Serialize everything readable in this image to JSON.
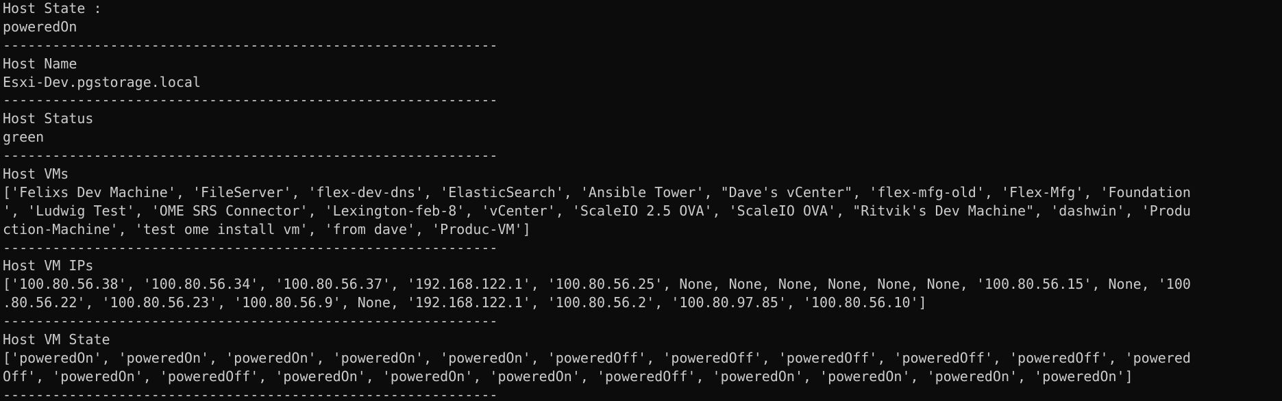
{
  "terminal": {
    "lines": [
      "Host State :",
      "poweredOn",
      "------------------------------------------------------------",
      "Host Name",
      "Esxi-Dev.pgstorage.local",
      "------------------------------------------------------------",
      "Host Status",
      "green",
      "------------------------------------------------------------",
      "Host VMs",
      "['Felixs Dev Machine', 'FileServer', 'flex-dev-dns', 'ElasticSearch', 'Ansible Tower', \"Dave's vCenter\", 'flex-mfg-old', 'Flex-Mfg', 'Foundation",
      "', 'Ludwig Test', 'OME SRS Connector', 'Lexington-feb-8', 'vCenter', 'ScaleIO 2.5 OVA', 'ScaleIO OVA', \"Ritvik's Dev Machine\", 'dashwin', 'Produ",
      "ction-Machine', 'test ome install vm', 'from dave', 'Produc-VM']",
      "------------------------------------------------------------",
      "Host VM IPs",
      "['100.80.56.38', '100.80.56.34', '100.80.56.37', '192.168.122.1', '100.80.56.25', None, None, None, None, None, None, '100.80.56.15', None, '100",
      ".80.56.22', '100.80.56.23', '100.80.56.9', None, '192.168.122.1', '100.80.56.2', '100.80.97.85', '100.80.56.10']",
      "------------------------------------------------------------",
      "Host VM State",
      "['poweredOn', 'poweredOn', 'poweredOn', 'poweredOn', 'poweredOn', 'poweredOff', 'poweredOff', 'poweredOff', 'poweredOff', 'poweredOff', 'powered",
      "Off', 'poweredOn', 'poweredOff', 'poweredOn', 'poweredOn', 'poweredOn', 'poweredOff', 'poweredOn', 'poweredOn', 'poweredOn', 'poweredOn']",
      "------------------------------------------------------------"
    ]
  },
  "colors": {
    "background": "#0c0c0c",
    "foreground": "#cccccc"
  }
}
